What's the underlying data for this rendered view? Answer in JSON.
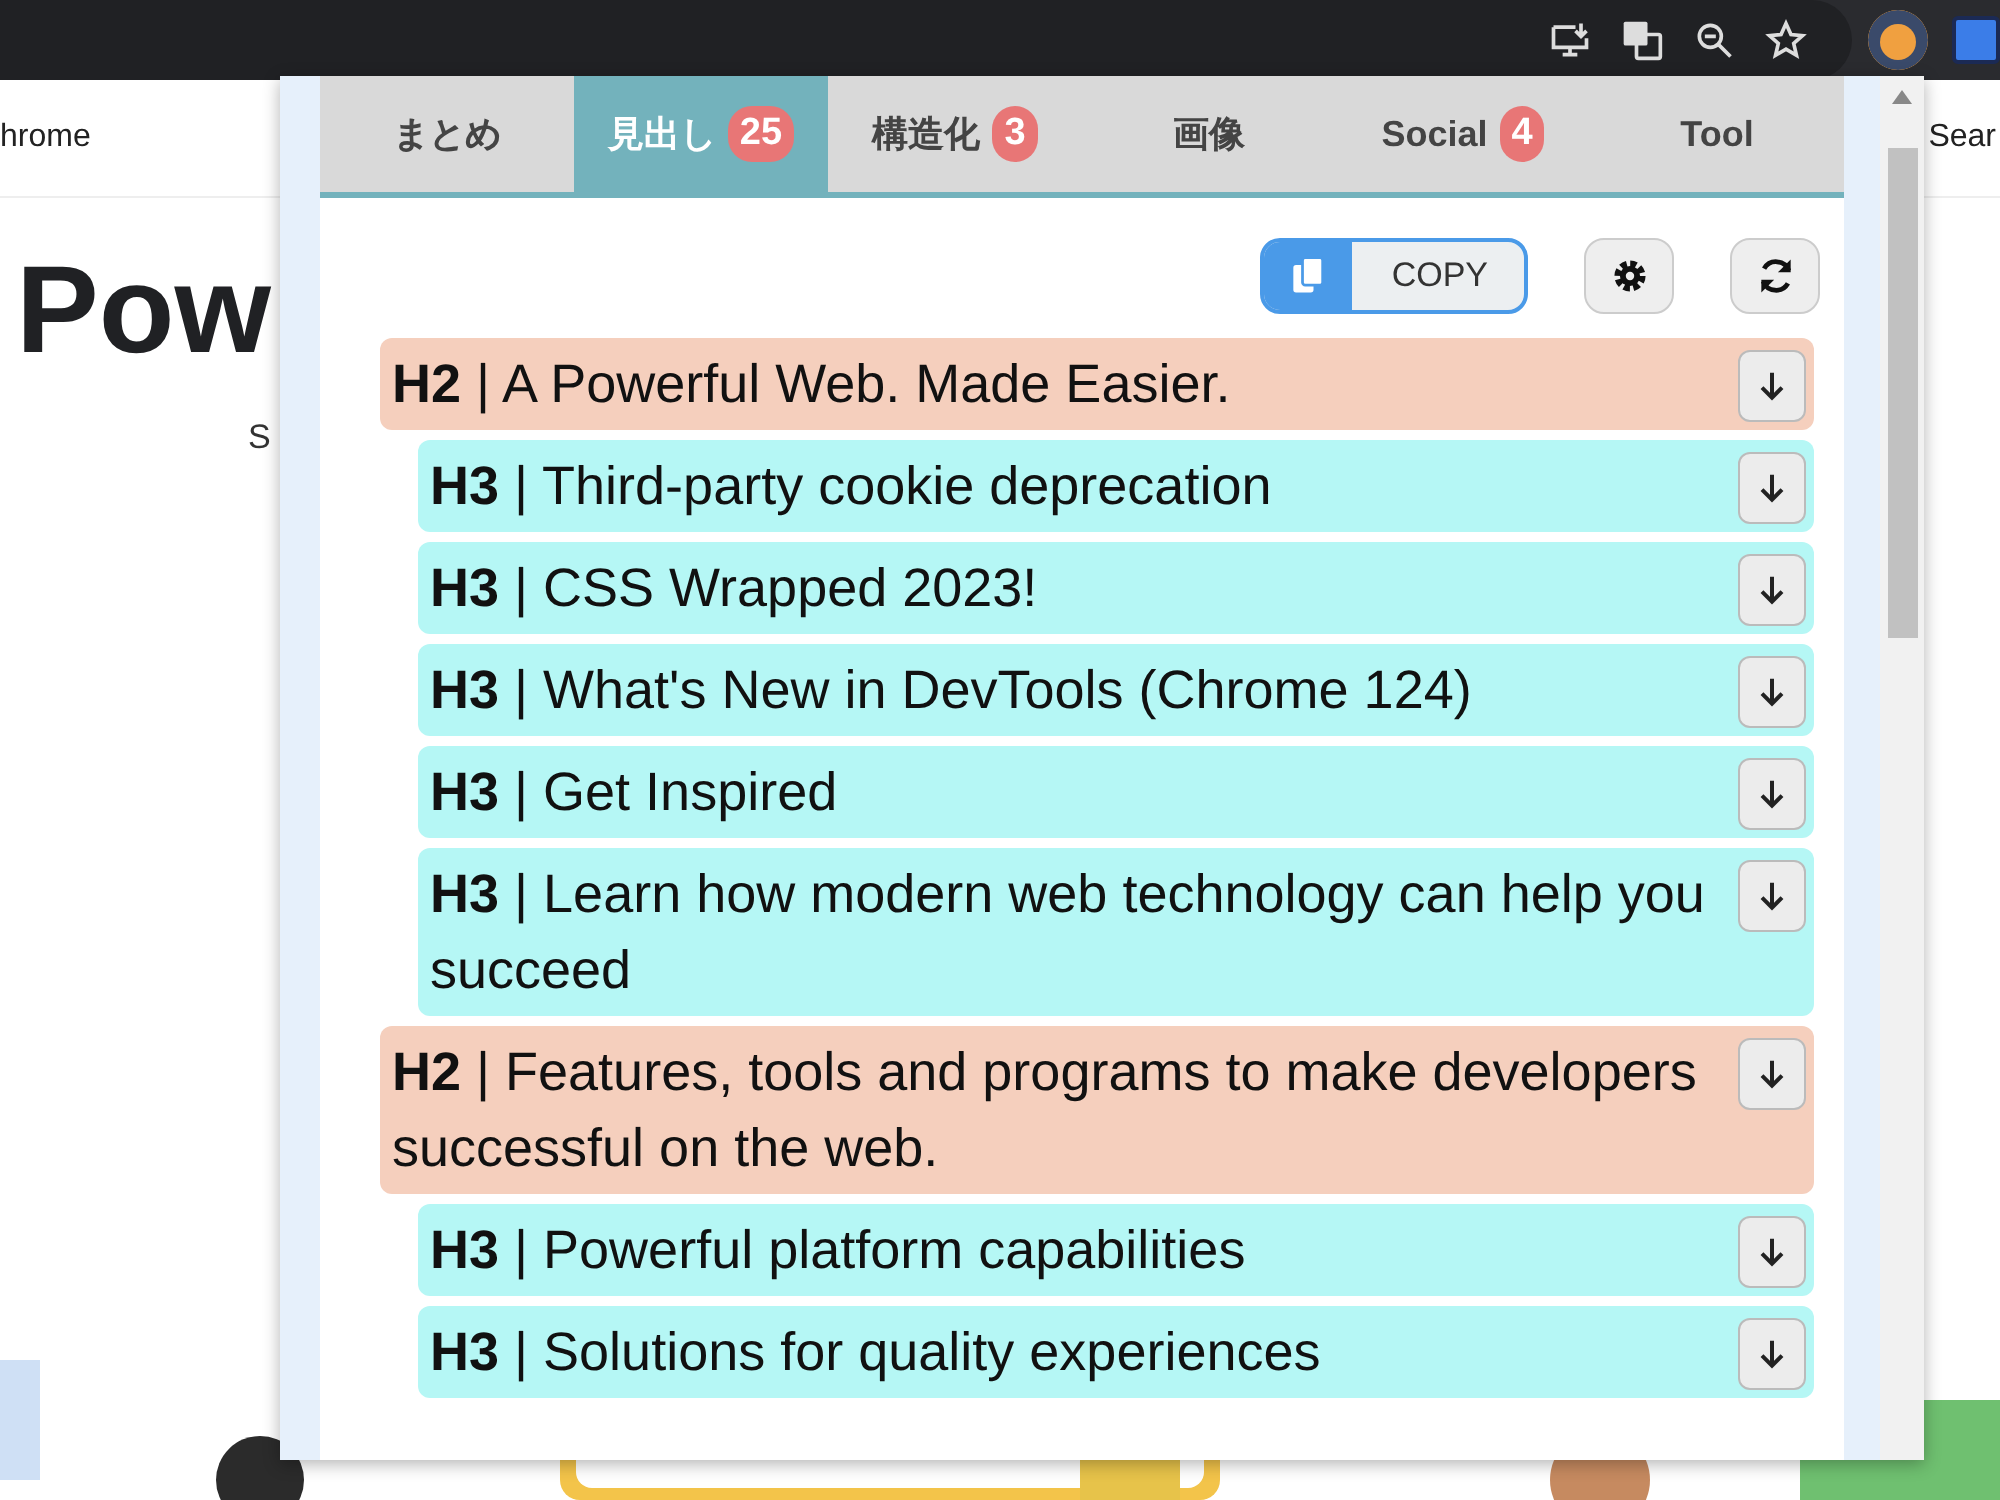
{
  "page": {
    "crumb": "hrome",
    "search": "Sear",
    "headline": "Pow",
    "subtitle": "S"
  },
  "tabs": [
    {
      "label": "まとめ",
      "selected": false
    },
    {
      "label": "見出し",
      "badge": "25",
      "selected": true
    },
    {
      "label": "構造化",
      "badge": "3",
      "selected": false
    },
    {
      "label": "画像",
      "selected": false
    },
    {
      "label": "Social",
      "badge": "4",
      "selected": false
    },
    {
      "label": "Tool",
      "selected": false
    }
  ],
  "toolbar": {
    "copy": "COPY"
  },
  "headings": [
    {
      "kind": "h2",
      "text": "**H2** | A Powerful Web. Made Easier.",
      "children": [
        {
          "kind": "h3",
          "text": "**H3** | Third-party cookie deprecation"
        },
        {
          "kind": "h3",
          "text": "**H3** | CSS Wrapped 2023!"
        },
        {
          "kind": "h3",
          "text": "**H3** | What's New in DevTools (Chrome 124)"
        },
        {
          "kind": "h3",
          "text": "**H3** | Get Inspired"
        },
        {
          "kind": "h3",
          "text": "**H3** | Learn how modern web technology can help you succeed"
        }
      ]
    },
    {
      "kind": "h2",
      "text": "**H2** | Features, tools and programs to make developers successful on the web.",
      "children": [
        {
          "kind": "h3",
          "text": "**H3** | Powerful platform capabilities"
        },
        {
          "kind": "h3",
          "text": "**H3** | Solutions for quality experiences"
        }
      ]
    }
  ]
}
